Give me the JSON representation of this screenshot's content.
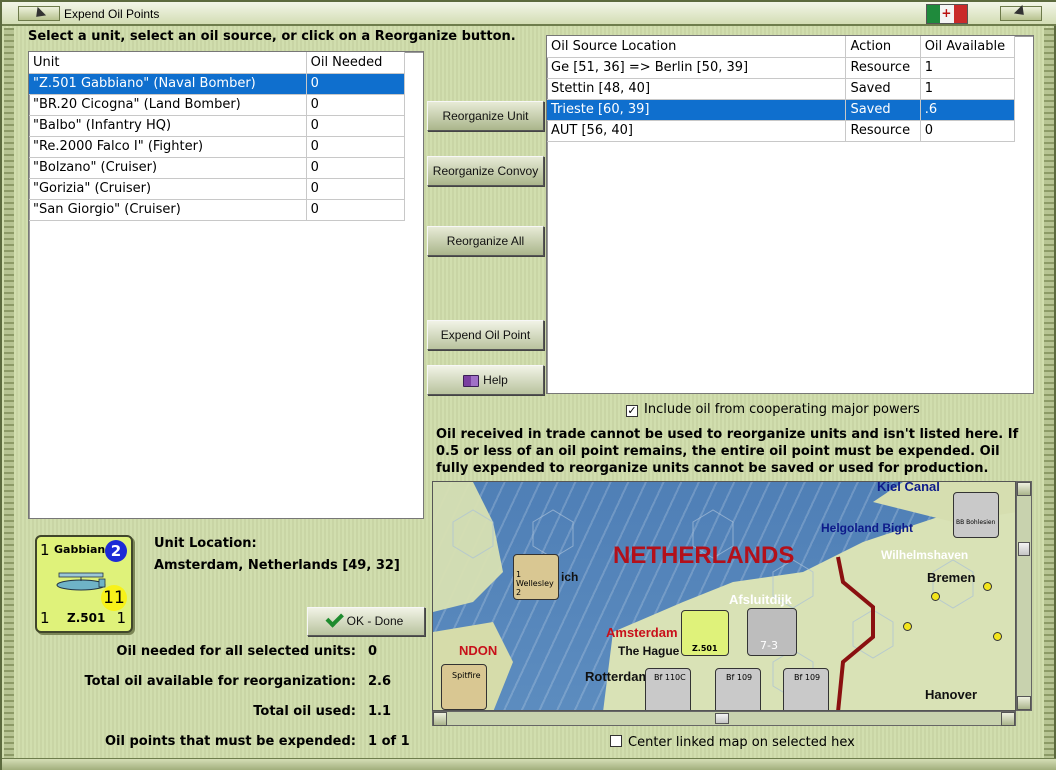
{
  "window": {
    "title": "Expend Oil Points"
  },
  "instruction": "Select a unit, select an oil source, or click on a Reorganize button.",
  "units_table": {
    "headers": [
      "Unit",
      "Oil Needed"
    ],
    "rows": [
      {
        "unit": "\"Z.501 Gabbiano\" (Naval Bomber)",
        "oil": "0",
        "selected": true
      },
      {
        "unit": "\"BR.20 Cicogna\" (Land Bomber)",
        "oil": "0",
        "selected": false
      },
      {
        "unit": "\"Balbo\" (Infantry HQ)",
        "oil": "0",
        "selected": false
      },
      {
        "unit": "\"Re.2000 Falco I\" (Fighter)",
        "oil": "0",
        "selected": false
      },
      {
        "unit": "\"Bolzano\" (Cruiser)",
        "oil": "0",
        "selected": false
      },
      {
        "unit": "\"Gorizia\" (Cruiser)",
        "oil": "0",
        "selected": false
      },
      {
        "unit": "\"San Giorgio\" (Cruiser)",
        "oil": "0",
        "selected": false
      }
    ]
  },
  "oil_table": {
    "headers": [
      "Oil Source Location",
      "Action",
      "Oil Available"
    ],
    "rows": [
      {
        "location": "Ge [51, 36] => Berlin [50, 39]",
        "action": "Resource",
        "available": "1",
        "selected": false
      },
      {
        "location": "Stettin [48, 40]",
        "action": "Saved",
        "available": "1",
        "selected": false
      },
      {
        "location": "Trieste [60, 39]",
        "action": "Saved",
        "available": ".6",
        "selected": true
      },
      {
        "location": "AUT [56, 40]",
        "action": "Resource",
        "available": "0",
        "selected": false
      }
    ]
  },
  "buttons": {
    "reorganize_unit": "Reorganize Unit",
    "reorganize_convoy": "Reorganize Convoy",
    "reorganize_all": "Reorganize All",
    "expend_oil_point": "Expend Oil Point",
    "help": "Help",
    "ok_done": "OK - Done"
  },
  "include_oil_checkbox": {
    "label": "Include oil from cooperating major powers",
    "checked": true
  },
  "note": "Oil received in trade cannot be used to reorganize units and isn't listed here.  If 0.5 or less of an oil point remains, the entire oil point must be expended.   Oil fully expended to reorganize units cannot be saved or used for production.",
  "unit_counter": {
    "name": "Gabbiano",
    "id": "Z.501",
    "top_left": "1",
    "blue_value": "2",
    "yellow_value": "11",
    "bottom_left": "1",
    "bottom_right": "1"
  },
  "unit_location": {
    "label": "Unit Location:",
    "value": "Amsterdam, Netherlands [49, 32]"
  },
  "stats": {
    "oil_needed": {
      "label": "Oil needed for all selected units:",
      "value": "0"
    },
    "total_available": {
      "label": "Total oil available for reorganization:",
      "value": "2.6"
    },
    "total_used": {
      "label": "Total oil used:",
      "value": "1.1"
    },
    "must_expend": {
      "label": "Oil points that must be expended:",
      "value": "1 of 1"
    }
  },
  "map": {
    "labels": {
      "netherlands": "NETHERLANDS",
      "kiel_canal": "Kiel Canal",
      "helgoland": "Helgoland Bight",
      "wilhelmshaven": "Wilhelmshaven",
      "bremen": "Bremen",
      "afsluitdijk": "Afsluitdijk",
      "amsterdam": "Amsterdam",
      "the_hague": "The Hague",
      "rotterdam": "Rotterdam",
      "london": "NDON",
      "hanover": "Hanover",
      "ich": "ich"
    },
    "counters": {
      "wellesley": "1 Wellesley 2",
      "gabbiano": "Z.501",
      "spitfire": "Spitfire",
      "bf110": "Bf 110C",
      "bf109a": "Bf 109",
      "bf109b": "Bf 109",
      "bohlesien": "BB Bohlesien",
      "army": "7-3"
    }
  },
  "center_map_checkbox": {
    "label": "Center linked map on selected hex",
    "checked": false
  },
  "colors": {
    "selection": "#0f6fce",
    "panel_bg": "#cfdcaa",
    "map_sea": "#5c8cbf",
    "country_label": "#b3101a"
  }
}
